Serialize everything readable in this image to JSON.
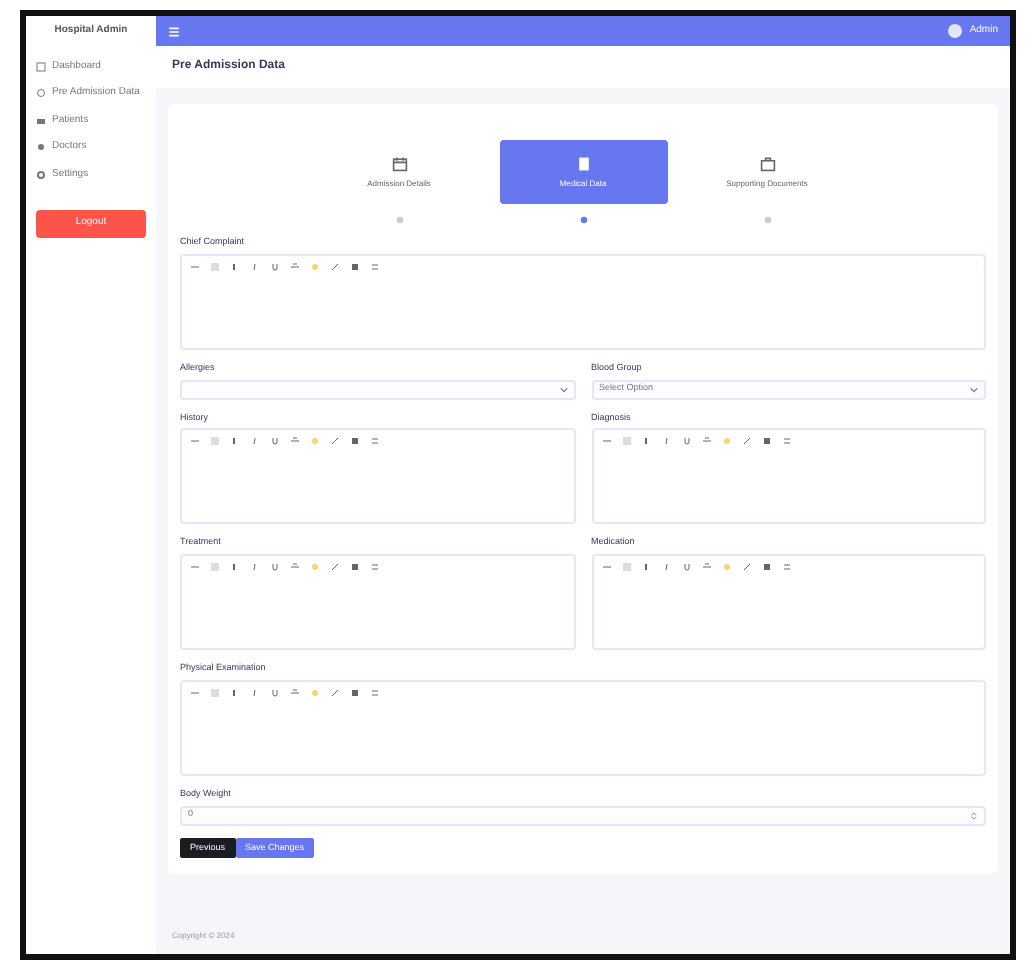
{
  "sidebar": {
    "brand": "Hospital Admin",
    "items": [
      {
        "label": "Dashboard",
        "selected": false
      },
      {
        "label": "Pre Admission Data",
        "selected": false
      },
      {
        "label": "Patients",
        "selected": false
      },
      {
        "label": "Doctors",
        "selected": false
      },
      {
        "label": "Settings",
        "selected": false
      }
    ],
    "logout": "Logout"
  },
  "topbar": {
    "user": "Admin"
  },
  "page_title": "Pre Admission Data",
  "steps": [
    {
      "label": "Admission Details",
      "selected": false
    },
    {
      "label": "Medical Data",
      "selected": true
    },
    {
      "label": "Supporting Documents",
      "selected": false
    }
  ],
  "rows": [
    [
      {
        "kind": "editor",
        "label": "Chief Complaint"
      }
    ],
    [
      {
        "kind": "select",
        "label": "Allergies"
      },
      {
        "kind": "select",
        "label": "Blood Group",
        "value": "Select Option"
      }
    ],
    [
      {
        "kind": "editor",
        "label": "History"
      },
      {
        "kind": "editor",
        "label": "Diagnosis"
      }
    ],
    [
      {
        "kind": "editor",
        "label": "Treatment"
      },
      {
        "kind": "editor",
        "label": "Medication"
      }
    ],
    [
      {
        "kind": "editor",
        "label": "Physical Examination"
      }
    ],
    [
      {
        "kind": "number",
        "label": "Body Weight",
        "value": "0"
      }
    ]
  ],
  "buttons": [
    {
      "label": "Previous",
      "kind": "secondary"
    },
    {
      "label": "Save Changes",
      "kind": "primary"
    }
  ],
  "footer": "Copyright © 2024"
}
